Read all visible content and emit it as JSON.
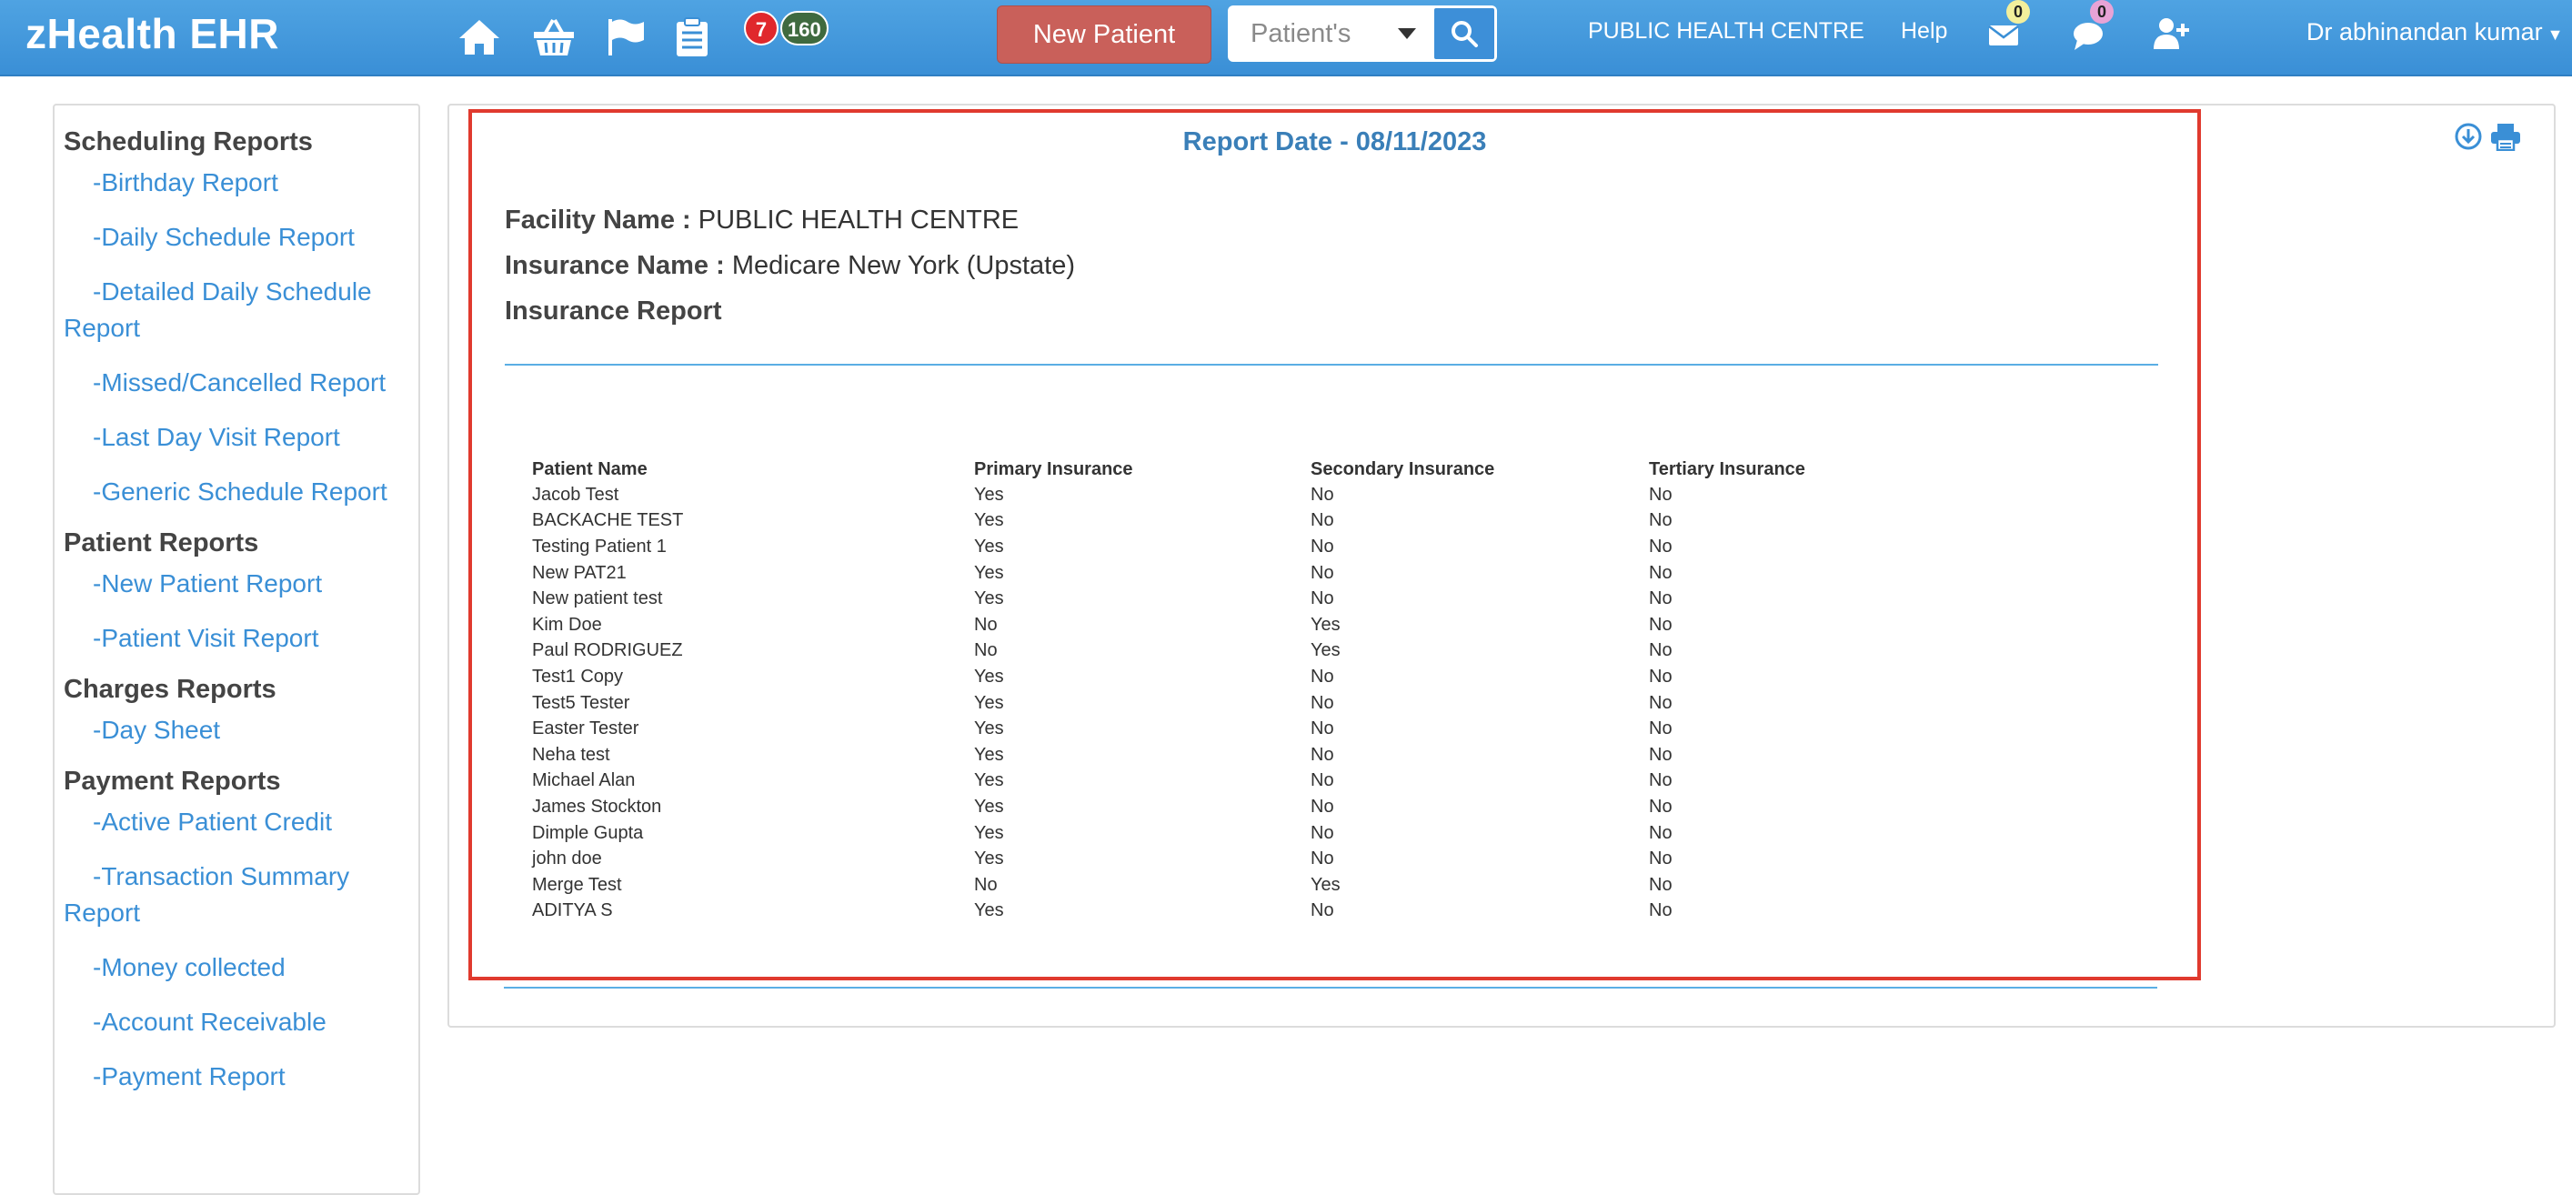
{
  "app": {
    "title": "zHealth EHR"
  },
  "navbar": {
    "icons": [
      "home-icon",
      "basket-icon",
      "flag-icon",
      "clipboard-icon"
    ],
    "badge_red": "7",
    "badge_green": "160",
    "new_patient_label": "New Patient",
    "search_select_value": "Patient's",
    "facility_link": "PUBLIC HEALTH CENTRE",
    "help_link": "Help",
    "mail_count": "0",
    "chat_count": "0",
    "user_menu": "Dr abhinandan kumar"
  },
  "sidebar": {
    "sections": [
      {
        "title": "Scheduling Reports",
        "items": [
          "-Birthday Report",
          "-Daily Schedule Report",
          "-Detailed Daily Schedule Report",
          "-Missed/Cancelled Report",
          "-Last Day Visit Report",
          "-Generic Schedule Report"
        ]
      },
      {
        "title": "Patient Reports",
        "items": [
          "-New Patient Report",
          "-Patient Visit Report"
        ]
      },
      {
        "title": "Charges Reports",
        "items": [
          "-Day Sheet"
        ]
      },
      {
        "title": "Payment Reports",
        "items": [
          "-Active Patient Credit",
          "-Transaction Summary Report",
          "-Money collected",
          "-Account Receivable",
          "-Payment Report"
        ]
      }
    ]
  },
  "report": {
    "date_line": "Report Date - 08/11/2023",
    "facility_label": "Facility Name :",
    "facility_value": "PUBLIC HEALTH CENTRE",
    "insurance_label": "Insurance Name :",
    "insurance_value": "Medicare New York (Upstate)",
    "report_title": "Insurance Report",
    "columns": [
      "Patient Name",
      "Primary Insurance",
      "Secondary Insurance",
      "Tertiary Insurance"
    ],
    "rows": [
      [
        "Jacob Test",
        "Yes",
        "No",
        "No"
      ],
      [
        "BACKACHE TEST",
        "Yes",
        "No",
        "No"
      ],
      [
        "Testing Patient 1",
        "Yes",
        "No",
        "No"
      ],
      [
        "New PAT21",
        "Yes",
        "No",
        "No"
      ],
      [
        "New patient test",
        "Yes",
        "No",
        "No"
      ],
      [
        "Kim Doe",
        "No",
        "Yes",
        "No"
      ],
      [
        "Paul RODRIGUEZ",
        "No",
        "Yes",
        "No"
      ],
      [
        "Test1 Copy",
        "Yes",
        "No",
        "No"
      ],
      [
        "Test5 Tester",
        "Yes",
        "No",
        "No"
      ],
      [
        "Easter Tester",
        "Yes",
        "No",
        "No"
      ],
      [
        "Neha test",
        "Yes",
        "No",
        "No"
      ],
      [
        "Michael Alan",
        "Yes",
        "No",
        "No"
      ],
      [
        "James Stockton",
        "Yes",
        "No",
        "No"
      ],
      [
        "Dimple Gupta",
        "Yes",
        "No",
        "No"
      ],
      [
        "john doe",
        "Yes",
        "No",
        "No"
      ],
      [
        "Merge Test",
        "No",
        "Yes",
        "No"
      ],
      [
        "ADITYA S",
        "Yes",
        "No",
        "No"
      ]
    ],
    "tools": [
      "download-icon",
      "print-icon"
    ]
  },
  "colors": {
    "navbar": "#3a8fd6",
    "new_patient_button": "#c9605a",
    "report_border": "#e03a2e",
    "link": "#3a8fd6"
  }
}
